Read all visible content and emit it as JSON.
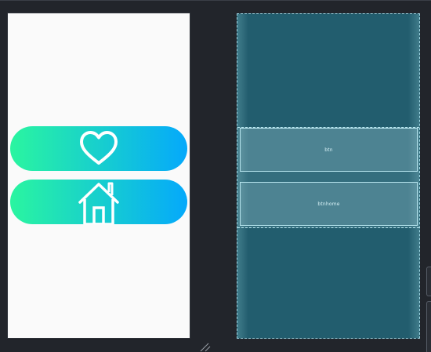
{
  "app": {
    "background": "#22252b"
  },
  "design_view": {
    "background": "#fafafa",
    "gradient_start": "#2af5a0",
    "gradient_end": "#05a9fb",
    "buttons": [
      {
        "icon": "heart-icon"
      },
      {
        "icon": "home-icon"
      }
    ]
  },
  "blueprint_view": {
    "background": "#225d6e",
    "outline": "#9fd6e3",
    "buttons": [
      {
        "id_label": "btn"
      },
      {
        "id_label": "btnhome"
      }
    ]
  }
}
